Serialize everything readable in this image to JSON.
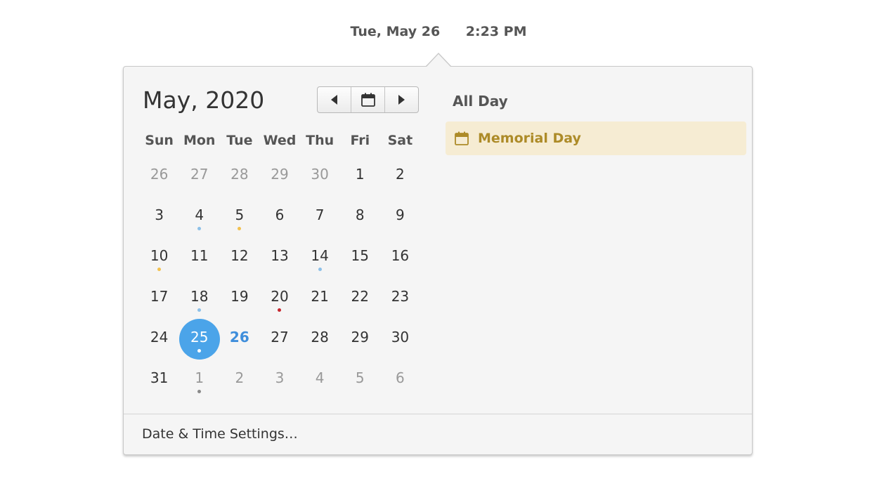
{
  "panel": {
    "date": "Tue, May 26",
    "time": "2:23 PM"
  },
  "calendar": {
    "month_title": "May, 2020",
    "nav": {
      "prev_icon": "go-previous-icon",
      "today_icon": "calendar-icon",
      "next_icon": "go-next-icon"
    },
    "weekdays": [
      "Sun",
      "Mon",
      "Tue",
      "Wed",
      "Thu",
      "Fri",
      "Sat"
    ],
    "weeks": [
      [
        {
          "n": "26",
          "other": true
        },
        {
          "n": "27",
          "other": true
        },
        {
          "n": "28",
          "other": true
        },
        {
          "n": "29",
          "other": true
        },
        {
          "n": "30",
          "other": true
        },
        {
          "n": "1"
        },
        {
          "n": "2"
        }
      ],
      [
        {
          "n": "3"
        },
        {
          "n": "4",
          "dot": "#8cc0e8"
        },
        {
          "n": "5",
          "dot": "#f2c14e"
        },
        {
          "n": "6"
        },
        {
          "n": "7"
        },
        {
          "n": "8"
        },
        {
          "n": "9"
        }
      ],
      [
        {
          "n": "10",
          "dot": "#f2c14e"
        },
        {
          "n": "11"
        },
        {
          "n": "12"
        },
        {
          "n": "13"
        },
        {
          "n": "14",
          "dot": "#8cc0e8"
        },
        {
          "n": "15"
        },
        {
          "n": "16"
        }
      ],
      [
        {
          "n": "17"
        },
        {
          "n": "18",
          "dot": "#8cc0e8"
        },
        {
          "n": "19"
        },
        {
          "n": "20",
          "dot": "#c6262e"
        },
        {
          "n": "21"
        },
        {
          "n": "22"
        },
        {
          "n": "23"
        }
      ],
      [
        {
          "n": "24"
        },
        {
          "n": "25",
          "selected": true,
          "dot": "#ffffff"
        },
        {
          "n": "26",
          "today": true
        },
        {
          "n": "27"
        },
        {
          "n": "28"
        },
        {
          "n": "29"
        },
        {
          "n": "30"
        }
      ],
      [
        {
          "n": "31"
        },
        {
          "n": "1",
          "other": true,
          "dot": "#8a8a8a"
        },
        {
          "n": "2",
          "other": true
        },
        {
          "n": "3",
          "other": true
        },
        {
          "n": "4",
          "other": true
        },
        {
          "n": "5",
          "other": true
        },
        {
          "n": "6",
          "other": true
        }
      ]
    ]
  },
  "events": {
    "all_day_title": "All Day",
    "items": [
      {
        "label": "Memorial Day",
        "icon": "calendar-icon",
        "color": "#ad8b28",
        "background": "#f6ecd3"
      }
    ]
  },
  "footer": {
    "settings_label": "Date & Time Settings…"
  },
  "colors": {
    "accent": "#4ba4e9",
    "today": "#3f8edb"
  }
}
